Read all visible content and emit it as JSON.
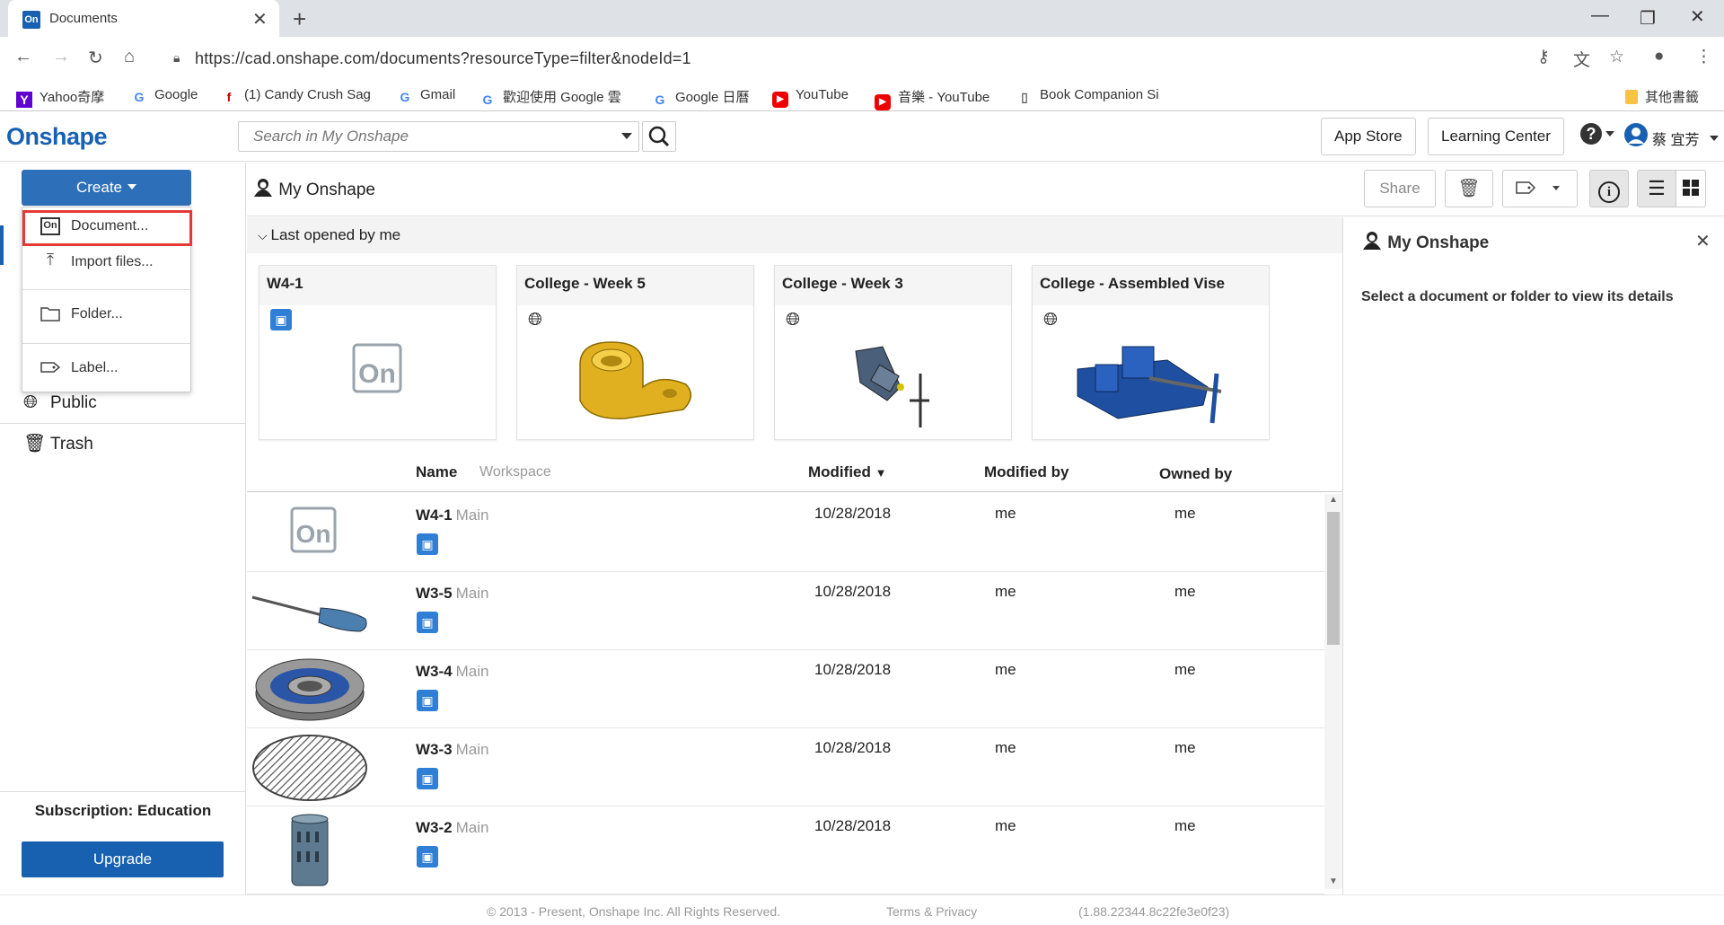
{
  "browser": {
    "tab_title": "Documents",
    "favicon_text": "On",
    "url": "https://cad.onshape.com/documents?resourceType=filter&nodeId=1",
    "bookmarks": [
      {
        "label": "Yahoo奇摩",
        "icon": "Y"
      },
      {
        "label": "Google",
        "icon": "G"
      },
      {
        "label": "(1) Candy Crush Sag",
        "icon": "f"
      },
      {
        "label": "Gmail",
        "icon": "G"
      },
      {
        "label": "歡迎使用 Google 雲",
        "icon": "G"
      },
      {
        "label": "Google 日曆",
        "icon": "G"
      },
      {
        "label": "YouTube",
        "icon": "▶"
      },
      {
        "label": "音樂 - YouTube",
        "icon": "▶"
      },
      {
        "label": "Book Companion Si",
        "icon": "▯"
      }
    ],
    "other_bookmarks": "其他書籤"
  },
  "header": {
    "logo": "Onshape",
    "search_placeholder": "Search in My Onshape",
    "app_store": "App Store",
    "learning_center": "Learning Center",
    "user_name": "蔡 宜芳"
  },
  "sidebar": {
    "create_label": "Create",
    "dropdown": {
      "document": "Document...",
      "import": "Import files...",
      "folder": "Folder...",
      "label": "Label..."
    },
    "public": "Public",
    "trash": "Trash",
    "subscription": "Subscription: Education",
    "upgrade": "Upgrade"
  },
  "main": {
    "breadcrumb": "My Onshape",
    "share": "Share",
    "last_opened": "Last opened by me",
    "recent": [
      {
        "title": "W4-1",
        "icon": "edu-icon"
      },
      {
        "title": "College - Week 5",
        "icon": "globe-icon"
      },
      {
        "title": "College - Week 3",
        "icon": "globe-icon"
      },
      {
        "title": "College - Assembled Vise",
        "icon": "globe-icon"
      }
    ],
    "columns": {
      "name": "Name",
      "workspace": "Workspace",
      "modified": "Modified",
      "modified_by": "Modified by",
      "owned_by": "Owned by"
    },
    "rows": [
      {
        "name": "W4-1",
        "workspace": "Main",
        "modified": "10/28/2018",
        "modified_by": "me",
        "owned_by": "me"
      },
      {
        "name": "W3-5",
        "workspace": "Main",
        "modified": "10/28/2018",
        "modified_by": "me",
        "owned_by": "me"
      },
      {
        "name": "W3-4",
        "workspace": "Main",
        "modified": "10/28/2018",
        "modified_by": "me",
        "owned_by": "me"
      },
      {
        "name": "W3-3",
        "workspace": "Main",
        "modified": "10/28/2018",
        "modified_by": "me",
        "owned_by": "me"
      },
      {
        "name": "W3-2",
        "workspace": "Main",
        "modified": "10/28/2018",
        "modified_by": "me",
        "owned_by": "me"
      }
    ]
  },
  "details_panel": {
    "title": "My Onshape",
    "message": "Select a document or folder to view its details"
  },
  "footer": {
    "copyright": "© 2013 - Present, Onshape Inc. All Rights Reserved.",
    "terms": "Terms & Privacy",
    "version": "(1.88.22344.8c22fe3e0f23)"
  },
  "colors": {
    "brand": "#1761b0",
    "create": "#2d6fb8",
    "highlight": "#e53935"
  }
}
